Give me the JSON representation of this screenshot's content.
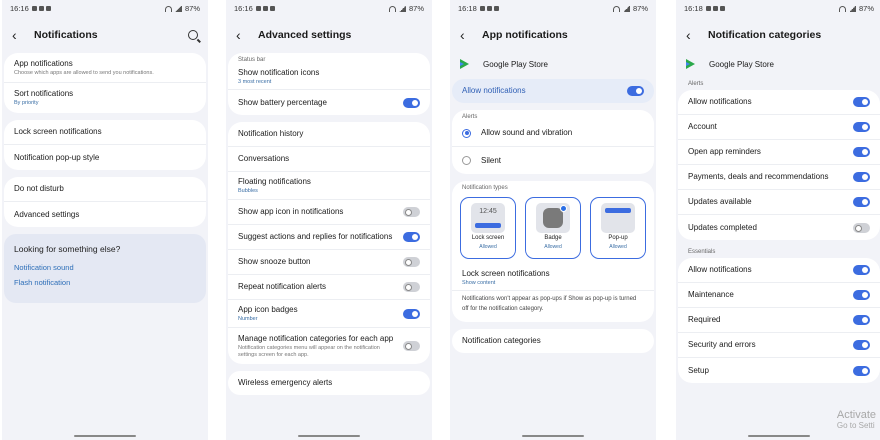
{
  "phones": [
    {
      "status": {
        "time": "16:16",
        "battery": "87%"
      },
      "title": "Notifications",
      "items": [
        {
          "label": "App notifications",
          "sub": "Choose which apps are allowed to send you notifications."
        },
        {
          "label": "Sort notifications",
          "sub": "By priority"
        }
      ],
      "items2": [
        {
          "label": "Lock screen notifications"
        },
        {
          "label": "Notification pop-up style"
        }
      ],
      "items3": [
        {
          "label": "Do not disturb"
        },
        {
          "label": "Advanced settings"
        }
      ],
      "looking": {
        "title": "Looking for something else?",
        "links": [
          "Notification sound",
          "Flash notification"
        ]
      }
    },
    {
      "status": {
        "time": "16:16",
        "battery": "87%"
      },
      "title": "Advanced settings",
      "section": "Status bar",
      "card1": [
        {
          "label": "Show notification icons",
          "sub": "3 most recent"
        },
        {
          "label": "Show battery percentage",
          "toggle": "on"
        }
      ],
      "card2": [
        {
          "label": "Notification history"
        },
        {
          "label": "Conversations"
        },
        {
          "label": "Floating notifications",
          "sub": "Bubbles"
        },
        {
          "label": "Show app icon in notifications",
          "toggle": "off"
        },
        {
          "label": "Suggest actions and replies for notifications",
          "toggle": "on"
        },
        {
          "label": "Show snooze button",
          "toggle": "off"
        },
        {
          "label": "Repeat notification alerts",
          "toggle": "off"
        },
        {
          "label": "App icon badges",
          "sub": "Number",
          "toggle": "on"
        },
        {
          "label": "Manage notification categories for each app",
          "sub": "Notification categories menu will appear on the notification settings screen for each app.",
          "toggle": "off"
        }
      ],
      "card3": [
        {
          "label": "Wireless emergency alerts"
        }
      ]
    },
    {
      "status": {
        "time": "16:18",
        "battery": "87%"
      },
      "title": "App notifications",
      "app": "Google Play Store",
      "allow": "Allow notifications",
      "alerts_header": "Alerts",
      "alerts": [
        {
          "label": "Allow sound and vibration",
          "selected": true
        },
        {
          "label": "Silent",
          "selected": false
        }
      ],
      "types_header": "Notification types",
      "types": [
        {
          "label": "Lock screen",
          "sub": "Allowed",
          "time": "12:45"
        },
        {
          "label": "Badge",
          "sub": "Allowed"
        },
        {
          "label": "Pop-up",
          "sub": "Allowed"
        }
      ],
      "lock": {
        "label": "Lock screen notifications",
        "sub": "Show content"
      },
      "note": "Notifications won't appear as pop-ups if Show as pop-up is turned off for the notification category.",
      "categories": "Notification categories"
    },
    {
      "status": {
        "time": "16:18",
        "battery": "87%"
      },
      "title": "Notification categories",
      "app": "Google Play Store",
      "alerts_header": "Alerts",
      "alerts": [
        {
          "label": "Allow notifications",
          "toggle": "on"
        },
        {
          "label": "Account",
          "toggle": "on"
        },
        {
          "label": "Open app reminders",
          "toggle": "on"
        },
        {
          "label": "Payments, deals and recommendations",
          "toggle": "on"
        },
        {
          "label": "Updates available",
          "toggle": "on"
        },
        {
          "label": "Updates completed",
          "toggle": "off"
        }
      ],
      "essentials_header": "Essentials",
      "essentials": [
        {
          "label": "Allow notifications",
          "toggle": "on"
        },
        {
          "label": "Maintenance",
          "toggle": "on"
        },
        {
          "label": "Required",
          "toggle": "on"
        },
        {
          "label": "Security and errors",
          "toggle": "on"
        },
        {
          "label": "Setup",
          "toggle": "on"
        }
      ]
    }
  ],
  "watermark": {
    "line1": "Activate",
    "line2": "Go to Setti"
  },
  "colors": {
    "accent": "#3c6ce0",
    "link": "#2e6fb8",
    "background": "#f2f3f8"
  }
}
